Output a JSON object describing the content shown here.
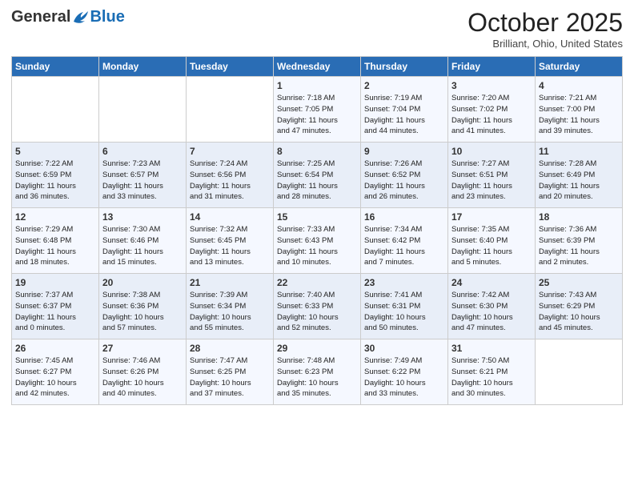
{
  "header": {
    "logo_general": "General",
    "logo_blue": "Blue",
    "month_title": "October 2025",
    "location": "Brilliant, Ohio, United States"
  },
  "days_of_week": [
    "Sunday",
    "Monday",
    "Tuesday",
    "Wednesday",
    "Thursday",
    "Friday",
    "Saturday"
  ],
  "weeks": [
    [
      {
        "day": "",
        "info": ""
      },
      {
        "day": "",
        "info": ""
      },
      {
        "day": "",
        "info": ""
      },
      {
        "day": "1",
        "info": "Sunrise: 7:18 AM\nSunset: 7:05 PM\nDaylight: 11 hours\nand 47 minutes."
      },
      {
        "day": "2",
        "info": "Sunrise: 7:19 AM\nSunset: 7:04 PM\nDaylight: 11 hours\nand 44 minutes."
      },
      {
        "day": "3",
        "info": "Sunrise: 7:20 AM\nSunset: 7:02 PM\nDaylight: 11 hours\nand 41 minutes."
      },
      {
        "day": "4",
        "info": "Sunrise: 7:21 AM\nSunset: 7:00 PM\nDaylight: 11 hours\nand 39 minutes."
      }
    ],
    [
      {
        "day": "5",
        "info": "Sunrise: 7:22 AM\nSunset: 6:59 PM\nDaylight: 11 hours\nand 36 minutes."
      },
      {
        "day": "6",
        "info": "Sunrise: 7:23 AM\nSunset: 6:57 PM\nDaylight: 11 hours\nand 33 minutes."
      },
      {
        "day": "7",
        "info": "Sunrise: 7:24 AM\nSunset: 6:56 PM\nDaylight: 11 hours\nand 31 minutes."
      },
      {
        "day": "8",
        "info": "Sunrise: 7:25 AM\nSunset: 6:54 PM\nDaylight: 11 hours\nand 28 minutes."
      },
      {
        "day": "9",
        "info": "Sunrise: 7:26 AM\nSunset: 6:52 PM\nDaylight: 11 hours\nand 26 minutes."
      },
      {
        "day": "10",
        "info": "Sunrise: 7:27 AM\nSunset: 6:51 PM\nDaylight: 11 hours\nand 23 minutes."
      },
      {
        "day": "11",
        "info": "Sunrise: 7:28 AM\nSunset: 6:49 PM\nDaylight: 11 hours\nand 20 minutes."
      }
    ],
    [
      {
        "day": "12",
        "info": "Sunrise: 7:29 AM\nSunset: 6:48 PM\nDaylight: 11 hours\nand 18 minutes."
      },
      {
        "day": "13",
        "info": "Sunrise: 7:30 AM\nSunset: 6:46 PM\nDaylight: 11 hours\nand 15 minutes."
      },
      {
        "day": "14",
        "info": "Sunrise: 7:32 AM\nSunset: 6:45 PM\nDaylight: 11 hours\nand 13 minutes."
      },
      {
        "day": "15",
        "info": "Sunrise: 7:33 AM\nSunset: 6:43 PM\nDaylight: 11 hours\nand 10 minutes."
      },
      {
        "day": "16",
        "info": "Sunrise: 7:34 AM\nSunset: 6:42 PM\nDaylight: 11 hours\nand 7 minutes."
      },
      {
        "day": "17",
        "info": "Sunrise: 7:35 AM\nSunset: 6:40 PM\nDaylight: 11 hours\nand 5 minutes."
      },
      {
        "day": "18",
        "info": "Sunrise: 7:36 AM\nSunset: 6:39 PM\nDaylight: 11 hours\nand 2 minutes."
      }
    ],
    [
      {
        "day": "19",
        "info": "Sunrise: 7:37 AM\nSunset: 6:37 PM\nDaylight: 11 hours\nand 0 minutes."
      },
      {
        "day": "20",
        "info": "Sunrise: 7:38 AM\nSunset: 6:36 PM\nDaylight: 10 hours\nand 57 minutes."
      },
      {
        "day": "21",
        "info": "Sunrise: 7:39 AM\nSunset: 6:34 PM\nDaylight: 10 hours\nand 55 minutes."
      },
      {
        "day": "22",
        "info": "Sunrise: 7:40 AM\nSunset: 6:33 PM\nDaylight: 10 hours\nand 52 minutes."
      },
      {
        "day": "23",
        "info": "Sunrise: 7:41 AM\nSunset: 6:31 PM\nDaylight: 10 hours\nand 50 minutes."
      },
      {
        "day": "24",
        "info": "Sunrise: 7:42 AM\nSunset: 6:30 PM\nDaylight: 10 hours\nand 47 minutes."
      },
      {
        "day": "25",
        "info": "Sunrise: 7:43 AM\nSunset: 6:29 PM\nDaylight: 10 hours\nand 45 minutes."
      }
    ],
    [
      {
        "day": "26",
        "info": "Sunrise: 7:45 AM\nSunset: 6:27 PM\nDaylight: 10 hours\nand 42 minutes."
      },
      {
        "day": "27",
        "info": "Sunrise: 7:46 AM\nSunset: 6:26 PM\nDaylight: 10 hours\nand 40 minutes."
      },
      {
        "day": "28",
        "info": "Sunrise: 7:47 AM\nSunset: 6:25 PM\nDaylight: 10 hours\nand 37 minutes."
      },
      {
        "day": "29",
        "info": "Sunrise: 7:48 AM\nSunset: 6:23 PM\nDaylight: 10 hours\nand 35 minutes."
      },
      {
        "day": "30",
        "info": "Sunrise: 7:49 AM\nSunset: 6:22 PM\nDaylight: 10 hours\nand 33 minutes."
      },
      {
        "day": "31",
        "info": "Sunrise: 7:50 AM\nSunset: 6:21 PM\nDaylight: 10 hours\nand 30 minutes."
      },
      {
        "day": "",
        "info": ""
      }
    ]
  ]
}
